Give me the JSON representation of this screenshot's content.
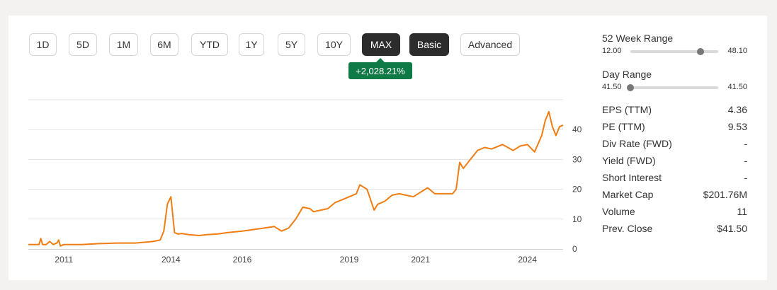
{
  "periods": [
    "1D",
    "5D",
    "1M",
    "6M",
    "YTD",
    "1Y",
    "5Y",
    "10Y",
    "MAX"
  ],
  "active_period": "MAX",
  "modes": [
    "Basic",
    "Advanced"
  ],
  "active_mode": "Basic",
  "change_badge": "+2,028.21%",
  "colors": {
    "line": "#f07d12",
    "badge": "#0f7a46",
    "active": "#2c2c2c"
  },
  "week52": {
    "title": "52 Week Range",
    "low": "12.00",
    "high": "48.10",
    "position": 0.8
  },
  "day_range": {
    "title": "Day Range",
    "low": "41.50",
    "high": "41.50",
    "position": 0.0
  },
  "stats": [
    {
      "label": "EPS (TTM)",
      "value": "4.36"
    },
    {
      "label": "PE (TTM)",
      "value": "9.53"
    },
    {
      "label": "Div Rate (FWD)",
      "value": "-"
    },
    {
      "label": "Yield (FWD)",
      "value": "-"
    },
    {
      "label": "Short Interest",
      "value": "-"
    },
    {
      "label": "Market Cap",
      "value": "$201.76M"
    },
    {
      "label": "Volume",
      "value": "11"
    },
    {
      "label": "Prev. Close",
      "value": "$41.50"
    }
  ],
  "chart_data": {
    "type": "line",
    "x_ticks": [
      "2011",
      "2014",
      "2016",
      "2019",
      "2021",
      "2024"
    ],
    "x_tick_values": [
      2011,
      2014,
      2016,
      2019,
      2021,
      2024
    ],
    "y_ticks": [
      "0",
      "10",
      "20",
      "30",
      "40"
    ],
    "y_tick_values": [
      0,
      10,
      20,
      30,
      40
    ],
    "ylim": [
      0,
      50
    ],
    "xlim": [
      2010.0,
      2025.0
    ],
    "grid": true,
    "series": [
      {
        "x": [
          2010.0,
          2010.3,
          2010.35,
          2010.4,
          2010.5,
          2010.6,
          2010.7,
          2010.8,
          2010.85,
          2010.9,
          2011.0,
          2011.5,
          2012.0,
          2012.5,
          2013.0,
          2013.5,
          2013.7,
          2013.8,
          2013.9,
          2014.0,
          2014.1,
          2014.2,
          2014.3,
          2014.5,
          2014.8,
          2015.0,
          2015.3,
          2015.6,
          2016.0,
          2016.3,
          2016.6,
          2016.9,
          2017.1,
          2017.3,
          2017.5,
          2017.7,
          2017.9,
          2018.0,
          2018.2,
          2018.4,
          2018.6,
          2018.8,
          2019.0,
          2019.2,
          2019.3,
          2019.5,
          2019.7,
          2019.8,
          2020.0,
          2020.2,
          2020.4,
          2020.6,
          2020.8,
          2021.0,
          2021.2,
          2021.4,
          2021.6,
          2021.8,
          2021.9,
          2022.0,
          2022.1,
          2022.2,
          2022.4,
          2022.6,
          2022.8,
          2023.0,
          2023.3,
          2023.6,
          2023.8,
          2024.0,
          2024.2,
          2024.4,
          2024.5,
          2024.6,
          2024.7,
          2024.8,
          2024.9,
          2025.0
        ],
        "y": [
          1.5,
          1.5,
          3.5,
          1.5,
          1.5,
          2.5,
          1.5,
          2.0,
          3.0,
          1.0,
          1.5,
          1.5,
          1.8,
          2.0,
          2.0,
          2.5,
          3.0,
          6.0,
          15.0,
          17.5,
          5.5,
          5.0,
          5.2,
          4.8,
          4.5,
          4.8,
          5.0,
          5.5,
          6.0,
          6.5,
          7.0,
          7.5,
          6.0,
          7.0,
          10.0,
          14.0,
          13.5,
          12.5,
          13.0,
          13.5,
          15.5,
          16.5,
          17.5,
          18.5,
          21.5,
          20.0,
          13.0,
          15.0,
          16.0,
          18.0,
          18.5,
          18.0,
          17.5,
          19.0,
          20.5,
          18.5,
          18.5,
          18.5,
          18.5,
          20.0,
          29.0,
          27.0,
          30.0,
          33.0,
          34.0,
          33.5,
          35.0,
          33.0,
          34.5,
          35.0,
          32.5,
          38.0,
          43.0,
          46.0,
          41.0,
          38.0,
          41.0,
          41.5
        ]
      }
    ]
  }
}
